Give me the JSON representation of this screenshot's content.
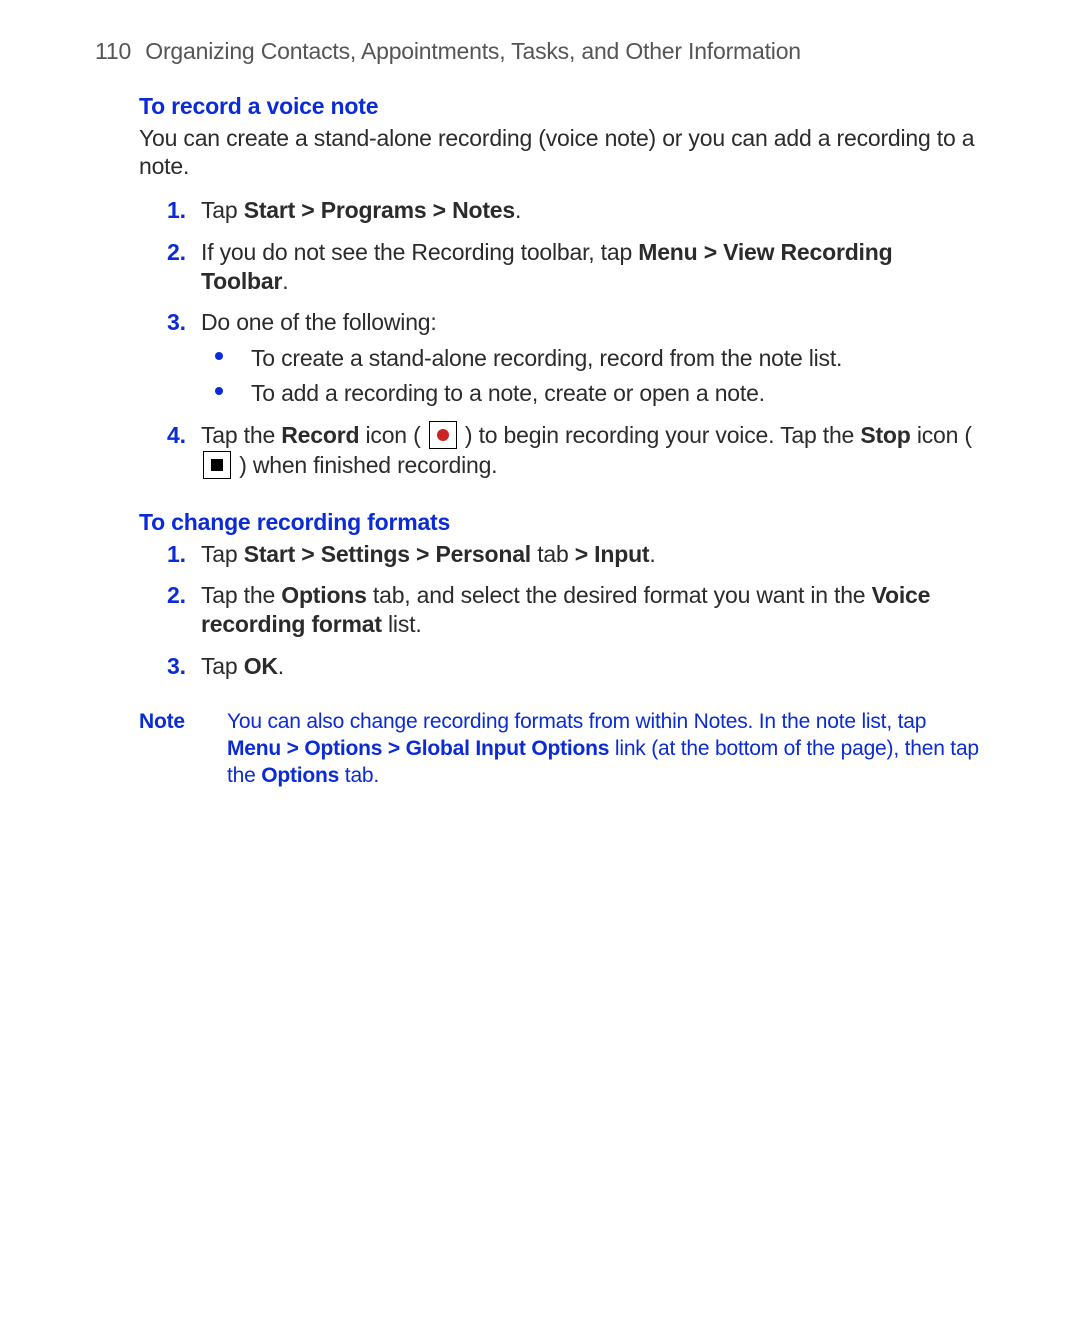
{
  "header": {
    "page_number": "110",
    "title": "Organizing Contacts, Appointments, Tasks, and Other Information"
  },
  "section1": {
    "heading": "To record a voice note",
    "intro": "You can create a stand-alone recording (voice note) or you can add a recording to a note.",
    "step1": {
      "num": "1.",
      "pre": "Tap ",
      "bold": "Start > Programs > Notes",
      "post": "."
    },
    "step2": {
      "num": "2.",
      "pre": "If you do not see the Recording toolbar, tap ",
      "bold": "Menu > View Recording Toolbar",
      "post": "."
    },
    "step3": {
      "num": "3.",
      "text": "Do one of the following:",
      "bullet1": "To create a stand-alone recording, record from the note list.",
      "bullet2": "To add a recording to a note, create or open a note."
    },
    "step4": {
      "num": "4.",
      "pre": "Tap the ",
      "b1": "Record",
      "mid1": " icon ( ",
      "mid2": " ) to begin recording your voice. Tap the ",
      "b2": "Stop",
      "mid3": " icon ( ",
      "post": " ) when finished recording."
    }
  },
  "section2": {
    "heading": "To change recording formats",
    "step1": {
      "num": "1.",
      "pre": "Tap ",
      "b1": "Start > Settings > Personal",
      "mid": " tab ",
      "b2": "> Input",
      "post": "."
    },
    "step2": {
      "num": "2.",
      "pre": "Tap the ",
      "b1": "Options",
      "mid": " tab, and select the desired format you want in the ",
      "b2": "Voice recording format",
      "post": " list."
    },
    "step3": {
      "num": "3.",
      "pre": "Tap ",
      "b1": "OK",
      "post": "."
    }
  },
  "note": {
    "label": "Note",
    "pre": "You can also change recording formats from within Notes. In the note list, tap ",
    "b1": "Menu > Options > Global Input Options",
    "mid": " link (at the bottom of the page), then tap the ",
    "b2": "Options",
    "post": " tab."
  }
}
